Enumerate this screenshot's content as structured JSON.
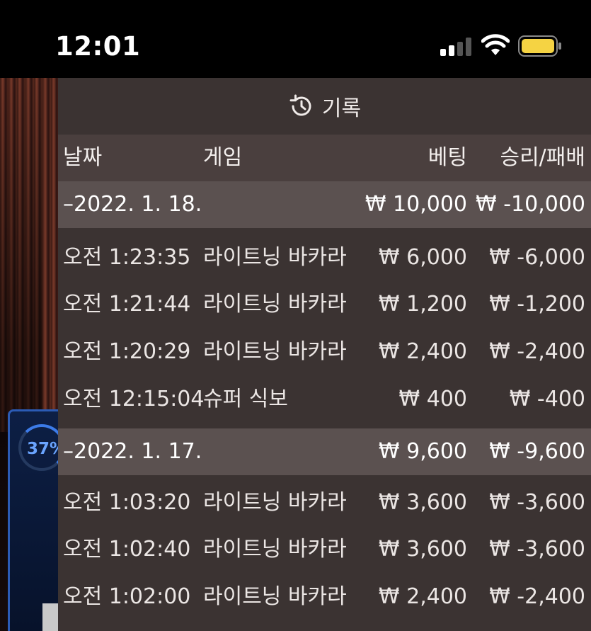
{
  "status_bar": {
    "time": "12:01"
  },
  "bg": {
    "progress_label": "37%"
  },
  "panel": {
    "title": "기록",
    "columns": {
      "date": "날짜",
      "game": "게임",
      "bet": "베팅",
      "result": "승리/패배"
    },
    "rows": [
      {
        "type": "date",
        "date": "–2022. 1. 18.",
        "game": "",
        "bet": "₩ 10,000",
        "result": "₩ -10,000"
      },
      {
        "type": "entry",
        "date": "오전 1:23:35",
        "game": "라이트닝 바카라",
        "bet": "₩ 6,000",
        "result": "₩ -6,000"
      },
      {
        "type": "entry",
        "date": "오전 1:21:44",
        "game": "라이트닝 바카라",
        "bet": "₩ 1,200",
        "result": "₩ -1,200"
      },
      {
        "type": "entry",
        "date": "오전 1:20:29",
        "game": "라이트닝 바카라",
        "bet": "₩ 2,400",
        "result": "₩ -2,400"
      },
      {
        "type": "entry",
        "date": "오전 12:15:04",
        "game": "슈퍼 식보",
        "bet": "₩ 400",
        "result": "₩ -400"
      },
      {
        "type": "date",
        "date": "–2022. 1. 17.",
        "game": "",
        "bet": "₩ 9,600",
        "result": "₩ -9,600"
      },
      {
        "type": "entry",
        "date": "오전 1:03:20",
        "game": "라이트닝 바카라",
        "bet": "₩ 3,600",
        "result": "₩ -3,600"
      },
      {
        "type": "entry",
        "date": "오전 1:02:40",
        "game": "라이트닝 바카라",
        "bet": "₩ 3,600",
        "result": "₩ -3,600"
      },
      {
        "type": "entry",
        "date": "오전 1:02:00",
        "game": "라이트닝 바카라",
        "bet": "₩ 2,400",
        "result": "₩ -2,400"
      }
    ]
  },
  "colors": {
    "panel_bg": "#3b3332",
    "header_row_bg": "#4a3f3e",
    "date_row_bg": "#5b5150",
    "battery_fill": "#f5d343",
    "accent_blue": "#3c7be8"
  }
}
